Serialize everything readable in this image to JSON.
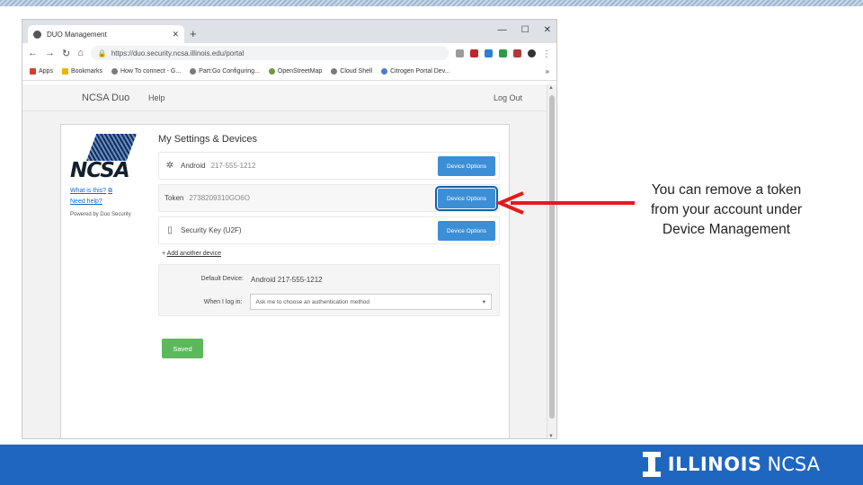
{
  "browser": {
    "tab_title": "DUO Management",
    "new_tab": "+",
    "tab_close": "✕",
    "win_min": "—",
    "win_max": "☐",
    "win_close": "✕",
    "url": "https://duo.security.ncsa.illinois.edu/portal",
    "bookmarks": [
      "Apps",
      "Bookmarks",
      "How To connect - G...",
      "Part:Go Configuring...",
      "OpenStreetMap",
      "Cloud Shell",
      "Citrogen Portal Dev..."
    ],
    "bookmarks_more": "»"
  },
  "duo": {
    "brand": "NCSA Duo",
    "help": "Help",
    "logout": "Log Out",
    "what_is_this": "What is this?",
    "need_help": "Need help?",
    "powered_by": "Powered by Duo Security",
    "ncsa_logo": "NCSA",
    "title": "My Settings & Devices",
    "devices": [
      {
        "name": "Android",
        "detail": "217-555-1212",
        "button": "Device Options"
      },
      {
        "name": "Token",
        "detail": "2738209310GO6O",
        "button": "Device Options"
      },
      {
        "name": "Security Key (U2F)",
        "detail": "",
        "button": "Device Options"
      }
    ],
    "add_device": "Add another device",
    "default_device_label": "Default Device:",
    "default_device_value": "Android 217-555-1212",
    "when_login_label": "When I log in:",
    "when_login_value": "Ask me to choose an authentication method",
    "saved": "Saved"
  },
  "callout": "You can remove a token from your account under Device Management",
  "footer": {
    "illinois": "ILLINOIS",
    "ncsa": "NCSA"
  },
  "colors": {
    "footer": "#1f66c1",
    "button": "#3c8ed6",
    "saved": "#5cb85c",
    "arrow": "#e31b1b"
  }
}
